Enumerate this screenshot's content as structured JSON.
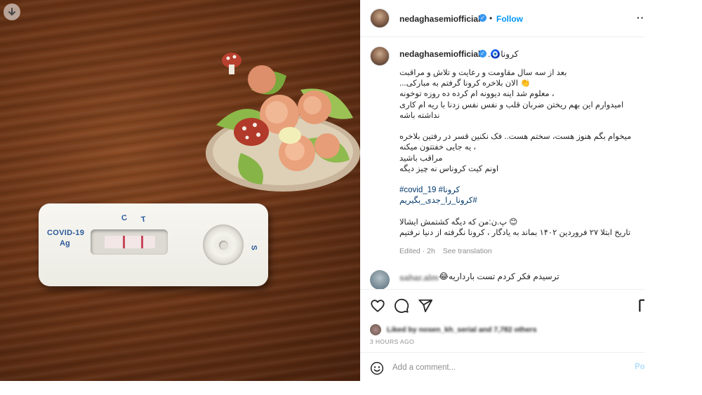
{
  "post_image": {
    "kit_label_line1": "COVID-19",
    "kit_label_line2": "Ag",
    "kit_c": "C",
    "kit_t": "T",
    "kit_s": "S"
  },
  "header": {
    "username": "nedaghasemiofficial",
    "dot": "•",
    "follow_label": "Follow",
    "more_label": "···"
  },
  "caption": {
    "username": "nedaghasemiofficial",
    "title": "کرونا🧿.",
    "lines": [
      "بعد از سه سال مقاومت و رعایت و تلاش و مراقبت",
      "👏 الان بلاخره کرونا گرفتم به مبارکی...",
      "، معلوم شد اینه دیوونه ام کرده ده روزه توخونه",
      "امیدوارم این بهم ریختن ضربان قلب و نفس نفس زدنا با ریه ام کاری",
      "نداشته باشه",
      "",
      "میخوام بگم هنوز هست، سختم هست.. فک نکنین قسر در رفتین بلاخره",
      "، یه جایی خفتتون میکنه",
      "مراقب باشید",
      "اونم کیت کروناس نه چیز دیگه",
      "",
      "#covid_19 #کرونا",
      "#کرونا_را_جدی_بگیریم",
      "",
      "😊 پ.ن:من که دیگه کشتمش ایشالا",
      "تاریخ ابتلا ۲۷ فروردین ۱۴۰۲ بماند به یادگار ، کرونا نگرفته از دنیا نرفتیم"
    ],
    "edited": "Edited · 2h",
    "see_translation": "See translation"
  },
  "comment": {
    "username": "sahar.alm",
    "text": "ترسیدم فکر کردم تست بارداریه😂"
  },
  "actions": {
    "like_icon": "heart-icon",
    "comment_icon": "comment-icon",
    "share_icon": "send-icon",
    "save_icon": "bookmark-icon"
  },
  "likes": {
    "text": "Liked by nosen_kh_serial and 7,782 others"
  },
  "time": "3 HOURS AGO",
  "add_comment": {
    "placeholder": "Add a comment...",
    "post_label": "Post"
  },
  "colors": {
    "accent": "#0095f6",
    "hashtag": "#00376b",
    "muted": "#8e8e8e",
    "verified": "#3897f0"
  }
}
